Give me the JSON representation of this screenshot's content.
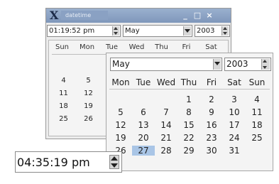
{
  "back_window": {
    "title": "datetime",
    "buttons": {
      "minimize": "_",
      "maximize": "□",
      "close": "×"
    },
    "time_value": "01:19:52 pm",
    "month_value": "May",
    "year_value": "2003",
    "weekday_headers": [
      "Sun",
      "Mon",
      "Tue",
      "Wed",
      "Thu",
      "Fri",
      "Sat"
    ],
    "visible_days": [
      [
        "4",
        "5"
      ],
      [
        "11",
        "12"
      ],
      [
        "18",
        "19"
      ],
      [
        "25",
        "26"
      ]
    ]
  },
  "front_window": {
    "month_value": "May",
    "year_value": "2003",
    "weekday_headers": [
      "Mon",
      "Tue",
      "Wed",
      "Thu",
      "Fri",
      "Sat",
      "Sun"
    ],
    "weeks": [
      [
        "",
        "",
        "",
        "1",
        "2",
        "3",
        "4"
      ],
      [
        "5",
        "6",
        "7",
        "8",
        "9",
        "10",
        "11"
      ],
      [
        "12",
        "13",
        "14",
        "15",
        "16",
        "17",
        "18"
      ],
      [
        "19",
        "20",
        "21",
        "22",
        "23",
        "24",
        "25"
      ],
      [
        "26",
        "27",
        "28",
        "29",
        "30",
        "31",
        ""
      ]
    ],
    "selected_day": "27"
  },
  "time_spin": {
    "value": "04:35:19 pm"
  },
  "colors": {
    "titlebar": "#8aa1c3",
    "selection": "#a9c5e6"
  }
}
